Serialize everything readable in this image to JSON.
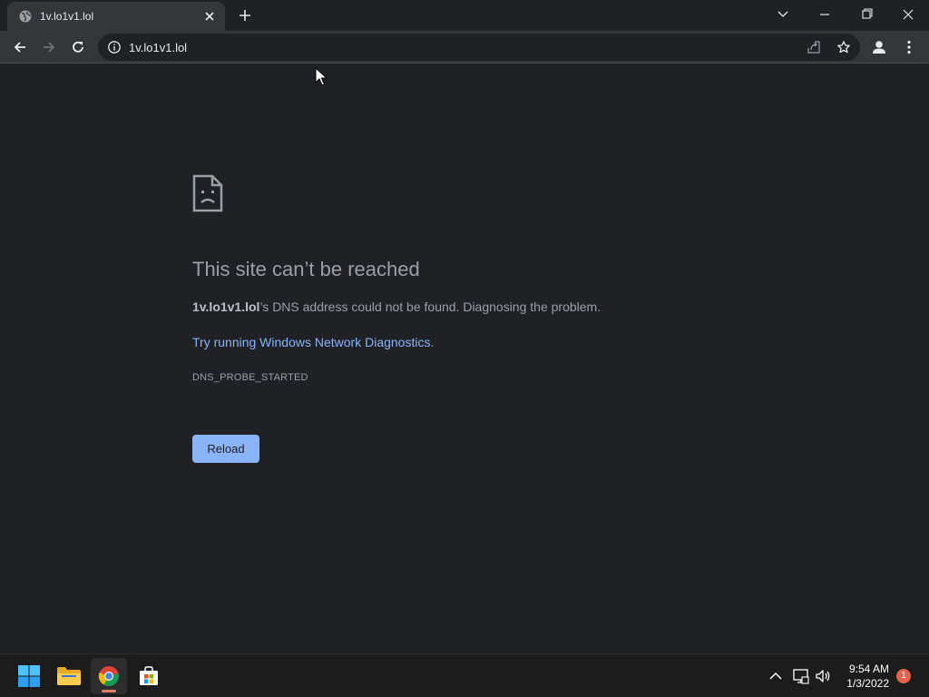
{
  "browser": {
    "tab": {
      "title": "1v.lo1v1.lol"
    },
    "address_bar": {
      "url": "1v.lo1v1.lol"
    }
  },
  "error_page": {
    "heading": "This site can’t be reached",
    "host": "1v.lo1v1.lol",
    "message_rest": "’s DNS address could not be found. Diagnosing the problem.",
    "link_text": "Try running Windows Network Diagnostics",
    "link_suffix": ".",
    "error_code": "DNS_PROBE_STARTED",
    "reload_label": "Reload"
  },
  "taskbar": {
    "time": "9:54 AM",
    "date": "1/3/2022",
    "notification_count": "1"
  },
  "colors": {
    "page_bg": "#202124",
    "link": "#8ab4f8",
    "button_bg": "#8ab4f8",
    "text_secondary": "#9aa0a6"
  }
}
